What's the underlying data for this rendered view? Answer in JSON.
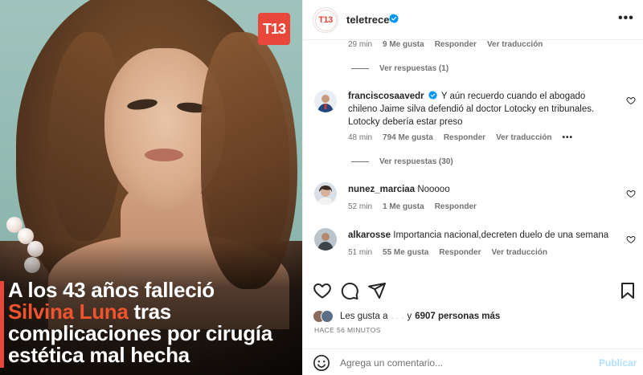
{
  "post": {
    "logo_text": "T13",
    "headline_line1": "A los 43 años falleció",
    "headline_accent": "Silvina Luna",
    "headline_rest1": " tras",
    "headline_line3": "complicaciones por cirugía",
    "headline_line4": "estética mal hecha",
    "accent_color": "#f0542f"
  },
  "header": {
    "avatar_text": "T13",
    "username": "teletrece",
    "more_icon": "more-horizontal-icon"
  },
  "comments": {
    "top_meta": {
      "time": "29 min",
      "likes": "9 Me gusta",
      "reply": "Responder",
      "translate": "Ver traducción"
    },
    "top_view_replies": "Ver respuestas (1)",
    "items": [
      {
        "username": "franciscosaavedr",
        "verified": true,
        "text": "Y aún recuerdo cuando el abogado chileno Jaime silva defendió al doctor Lotocky en tribunales. Lotocky debería estar preso",
        "time": "48 min",
        "likes": "794 Me gusta",
        "reply": "Responder",
        "translate": "Ver traducción",
        "view_replies": "Ver respuestas (30)"
      },
      {
        "username": "nunez_marciaa",
        "text": "Nooooo",
        "time": "52 min",
        "likes": "1 Me gusta",
        "reply": "Responder"
      },
      {
        "username": "alkarosse",
        "text": "Importancia nacional,decreten duelo de una semana",
        "time": "51 min",
        "likes": "55 Me gusta",
        "reply": "Responder",
        "translate": "Ver traducción"
      }
    ]
  },
  "likes": {
    "prefix": "Les gusta a",
    "hidden_user": ". . .",
    "and": "y",
    "count": "6907 personas más"
  },
  "time_ago": "HACE 56 MINUTOS",
  "comment_box": {
    "placeholder": "Agrega un comentario...",
    "publish": "Publicar"
  }
}
